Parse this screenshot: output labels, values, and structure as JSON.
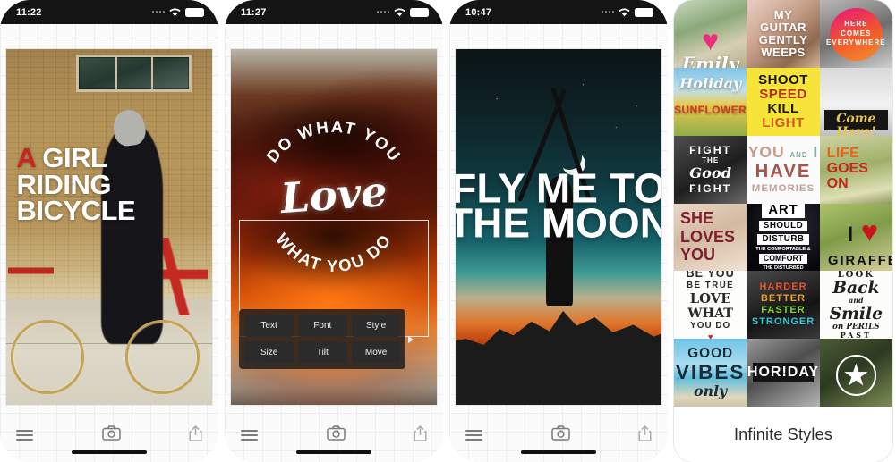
{
  "phones": [
    {
      "id": "phone-bicycle",
      "status": {
        "time": "11:22",
        "wifi_icon": "wifi-icon",
        "battery_icon": "battery-icon",
        "signal_icon": "signal-dots-icon"
      },
      "artwork": {
        "name": "bicycle-photo",
        "line1_accent": "A",
        "line1_rest": " GIRL",
        "line2": "RIDING",
        "line3": "BICYCLE",
        "accent_color": "#c6261f",
        "text_color": "#ffffff"
      },
      "toolbar": {
        "menu_label": "menu-icon",
        "camera_label": "camera-icon",
        "share_label": "share-icon"
      }
    },
    {
      "id": "phone-sunset",
      "status": {
        "time": "11:27",
        "wifi_icon": "wifi-icon",
        "battery_icon": "battery-icon",
        "signal_icon": "signal-dots-icon"
      },
      "artwork": {
        "name": "sunset-photo",
        "arc_top": "DO WHAT YOU",
        "center_script": "Love",
        "arc_bottom": "WHAT YOU DO"
      },
      "edit_panel": {
        "buttons": [
          "Text",
          "Font",
          "Style",
          "Size",
          "Tilt",
          "Move"
        ],
        "more_arrow": "chevron-right-icon"
      },
      "toolbar": {
        "menu_label": "menu-icon",
        "camera_label": "camera-icon",
        "share_label": "share-icon"
      }
    },
    {
      "id": "phone-moon",
      "status": {
        "time": "10:47",
        "wifi_icon": "wifi-icon",
        "battery_icon": "battery-icon",
        "signal_icon": "signal-dots-icon"
      },
      "artwork": {
        "name": "moon-photo",
        "line1": "FLY ME TO",
        "line2": "THE MOON"
      },
      "toolbar": {
        "menu_label": "menu-icon",
        "camera_label": "camera-icon",
        "share_label": "share-icon"
      }
    }
  ],
  "gallery": {
    "caption": "Infinite Styles",
    "tiles": [
      {
        "name": "tile-emily",
        "text": "Emily",
        "bg": "bg-emily",
        "style": "script-heart",
        "color": "#ffffff",
        "size": 20
      },
      {
        "name": "tile-guitar",
        "text": "MY GUITAR GENTLY WEEPS",
        "bg": "bg-guitar",
        "style": "block",
        "color": "#ffffff",
        "size": 13
      },
      {
        "name": "tile-here",
        "text": "HERE COMES EVERYWHERE",
        "bg": "bg-here",
        "style": "circle-badge",
        "color": "#ffffff",
        "size": 8
      },
      {
        "name": "tile-holiday",
        "text": "Holiday SUNFLOWER",
        "bg": "bg-holiday",
        "style": "script-two",
        "color": "#ffffff",
        "size": 14
      },
      {
        "name": "tile-shoot",
        "text": "SHOOT SPEED KILL LIGHT",
        "bg": "bg-shoot",
        "style": "stacked-dark",
        "color": "#1d1d1d",
        "size": 15
      },
      {
        "name": "tile-come",
        "text": "Come Here!",
        "bg": "bg-come",
        "style": "script-bar",
        "color": "#e0b93a",
        "size": 14
      },
      {
        "name": "tile-fight",
        "text": "FIGHT THE Good FIGHT",
        "bg": "bg-fight",
        "style": "mixed-white",
        "color": "#ffffff",
        "size": 13
      },
      {
        "name": "tile-memories",
        "text": "YOU AND I HAVE MEMORIES",
        "bg": "bg-mem",
        "style": "stacked-pastel",
        "color": "#b98f7e",
        "size": 14
      },
      {
        "name": "tile-life",
        "text": "LIFE GOES ON",
        "bg": "bg-life",
        "style": "stacked-red",
        "color": "#cf3a1e",
        "size": 16
      },
      {
        "name": "tile-she",
        "text": "SHE LOVES YOU",
        "bg": "bg-she",
        "style": "stacked-maroon",
        "color": "#7d2030",
        "size": 18
      },
      {
        "name": "tile-art",
        "text": "ART SHOULD DISTURB THE COMFORTABLE & COMFORT THE DISTURBED",
        "bg": "bg-art",
        "style": "boxed-white",
        "color": "#ffffff",
        "size": 7
      },
      {
        "name": "tile-giraffe",
        "text": "I ♥ GIRAFFE",
        "bg": "bg-giraffe",
        "style": "heart-big",
        "color": "#111111",
        "size": 16
      },
      {
        "name": "tile-beyou",
        "text": "BE YOU BE TRUE LOVE WHAT YOU DO",
        "bg": "bg-beyou",
        "style": "poster-dark",
        "color": "#2a2a2a",
        "size": 11
      },
      {
        "name": "tile-harder",
        "text": "HARDER BETTER FASTER STRONGER",
        "bg": "bg-harder",
        "style": "neon-rows",
        "color": "#e8522e",
        "size": 11
      },
      {
        "name": "tile-look",
        "text": "LOOK Back and Smile on PERILS PAST",
        "bg": "bg-look",
        "style": "ornate",
        "color": "#1f1f1f",
        "size": 11
      },
      {
        "name": "tile-vibes",
        "text": "GOOD VIBES only",
        "bg": "bg-vibes",
        "style": "beach",
        "color": "#1d2b36",
        "size": 15
      },
      {
        "name": "tile-horiday",
        "text": "HOR!DAY",
        "bg": "bg-horiday",
        "style": "outline-white",
        "color": "#ffffff",
        "size": 16
      },
      {
        "name": "tile-eagle",
        "text": "★",
        "bg": "bg-eagle",
        "style": "star-badge",
        "color": "#ffffff",
        "size": 20
      }
    ]
  }
}
